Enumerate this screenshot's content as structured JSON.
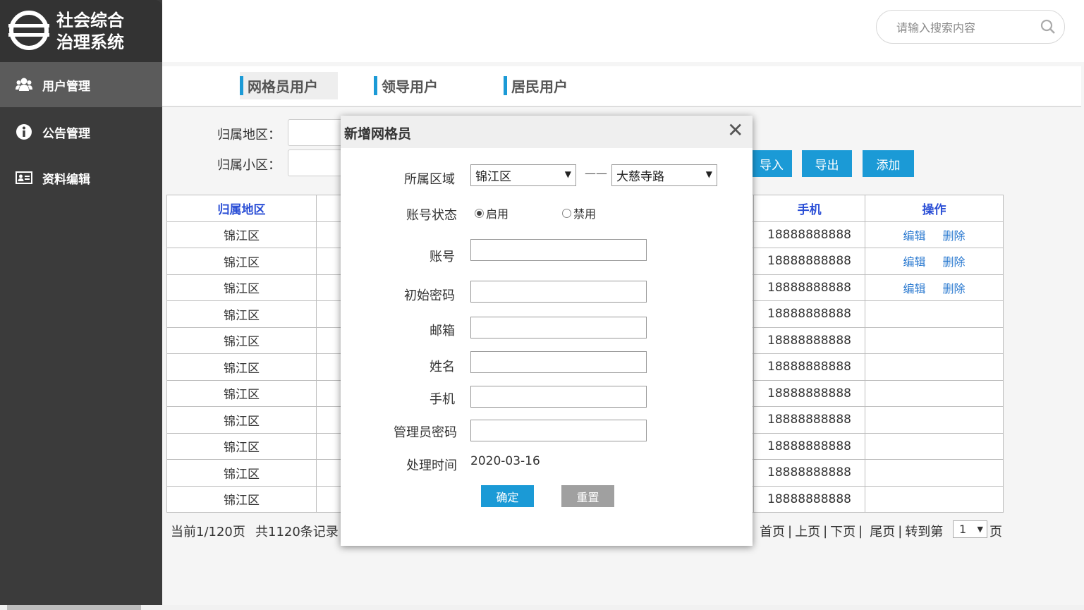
{
  "app": {
    "title_line1": "社会综合",
    "title_line2": "治理系统"
  },
  "sidebar": {
    "items": [
      {
        "label": "用户管理",
        "icon": "users-icon",
        "active": true
      },
      {
        "label": "公告管理",
        "icon": "info-icon",
        "active": false
      },
      {
        "label": "资料编辑",
        "icon": "id-card-icon",
        "active": false
      }
    ]
  },
  "header": {
    "search_placeholder": "请输入搜索内容"
  },
  "tabs": [
    {
      "label": "网格员用户",
      "active": true
    },
    {
      "label": "领导用户",
      "active": false
    },
    {
      "label": "居民用户",
      "active": false
    }
  ],
  "filters": {
    "region_label": "归属地区：",
    "community_label": "归属小区："
  },
  "actions": {
    "import": "导入",
    "export": "导出",
    "add": "添加"
  },
  "table": {
    "headers": {
      "region": "归属地区",
      "phone": "手机",
      "ops": "操作"
    },
    "rows": [
      {
        "region": "锦江区",
        "phone": "18888888888",
        "edit": "编辑",
        "delete": "删除"
      },
      {
        "region": "锦江区",
        "phone": "18888888888",
        "edit": "编辑",
        "delete": "删除"
      },
      {
        "region": "锦江区",
        "phone": "18888888888",
        "edit": "编辑",
        "delete": "删除"
      },
      {
        "region": "锦江区",
        "phone": "18888888888",
        "edit": "",
        "delete": ""
      },
      {
        "region": "锦江区",
        "phone": "18888888888",
        "edit": "",
        "delete": ""
      },
      {
        "region": "锦江区",
        "phone": "18888888888",
        "edit": "",
        "delete": ""
      },
      {
        "region": "锦江区",
        "phone": "18888888888",
        "edit": "",
        "delete": ""
      },
      {
        "region": "锦江区",
        "phone": "18888888888",
        "edit": "",
        "delete": ""
      },
      {
        "region": "锦江区",
        "phone": "18888888888",
        "edit": "",
        "delete": ""
      },
      {
        "region": "锦江区",
        "phone": "18888888888",
        "edit": "",
        "delete": ""
      },
      {
        "region": "锦江区",
        "phone": "18888888888",
        "edit": "",
        "delete": ""
      }
    ]
  },
  "pagination": {
    "current": "当前1/120页",
    "total": "共1120条记录",
    "first": "首页",
    "prev": "上页",
    "next": "下页",
    "last": "尾页",
    "goto": "转到第",
    "page_value": "1",
    "page_suffix": "页",
    "sep": "|"
  },
  "modal": {
    "title": "新增网格员",
    "close": "✕",
    "region_label": "所属区域",
    "district_value": "锦江区",
    "dash": "——",
    "road_value": "大慈寺路",
    "status_label": "账号状态",
    "status_enabled": "启用",
    "status_disabled": "禁用",
    "status_selected": "启用",
    "account_label": "账号",
    "password_label": "初始密码",
    "email_label": "邮箱",
    "name_label": "姓名",
    "phone_label": "手机",
    "admin_password_label": "管理员密码",
    "time_label": "处理时间",
    "time_value": "2020-03-16",
    "confirm": "确定",
    "reset": "重置"
  },
  "colors": {
    "sidebar_bg": "#3b3b3b",
    "sidebar_active": "#5b5b5b",
    "accent": "#1b9ad6",
    "header_text": "#2b4fd6",
    "link": "#2b7ad0",
    "reset_btn": "#a0a0a0"
  }
}
